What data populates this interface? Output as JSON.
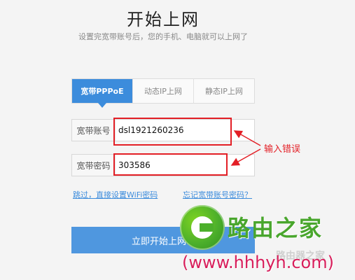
{
  "page": {
    "title": "开始上网",
    "subtitle": "设置完宽带账号后，您的手机、电脑就可以上网了"
  },
  "tabs": [
    {
      "label": "宽带PPPoE",
      "active": true
    },
    {
      "label": "动态IP上网",
      "active": false
    },
    {
      "label": "静态IP上网",
      "active": false
    }
  ],
  "form": {
    "account_label": "宽带账号",
    "account_value": "dsl1921260236",
    "password_label": "宽带密码",
    "password_value": "303586"
  },
  "links": {
    "skip": "跳过，直接设置WiFi密码",
    "forgot": "忘记宽带账号密码？"
  },
  "buttons": {
    "start": "立即开始上网"
  },
  "annotation": {
    "text": "输入错误",
    "color": "#e31f26"
  },
  "watermark": {
    "brand": "路由之家",
    "faint": "路由器之家",
    "url": "(www.hhhyh.com)"
  },
  "colors": {
    "accent": "#3c8cdc",
    "button": "#4f97df",
    "brand_green": "#49a62d",
    "url_pink": "#d81e5b"
  }
}
